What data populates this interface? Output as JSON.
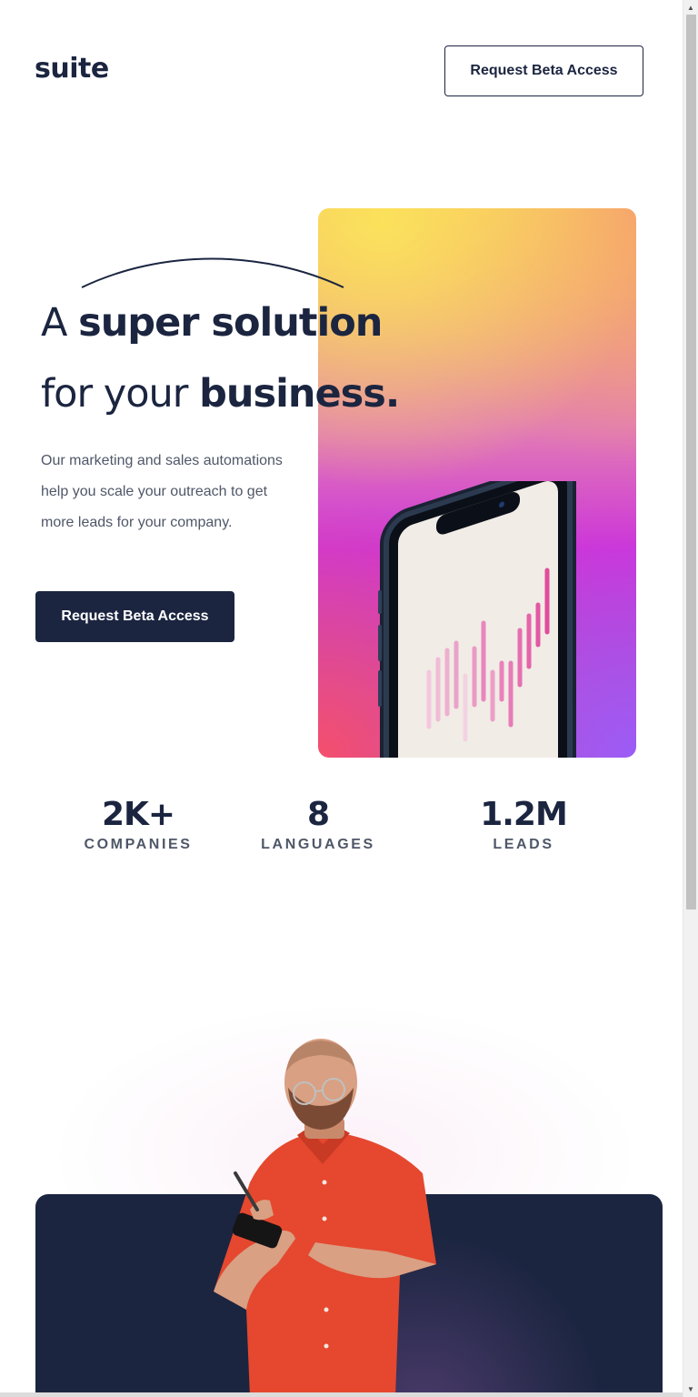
{
  "header": {
    "logo": "suite",
    "cta_label": "Request Beta Access"
  },
  "hero": {
    "headline_line1_light": "A ",
    "headline_line1_bold": "super solution",
    "headline_line2_light": "for your ",
    "headline_line2_bold": "business.",
    "description_line1": "Our marketing and sales automations",
    "description_line2": "help you scale your outreach to get",
    "description_line3": "more leads for your company.",
    "cta_label": "Request Beta Access"
  },
  "stats": [
    {
      "value": "2K+",
      "label": "COMPANIES"
    },
    {
      "value": "8",
      "label": "LANGUAGES"
    },
    {
      "value": "1.2M",
      "label": "LEADS"
    }
  ],
  "colors": {
    "navy": "#1b2540",
    "text_gray": "#4f5768",
    "gradient_yellow": "#fbe15c",
    "gradient_magenta": "#cc36d9",
    "gradient_red": "#f44f6c",
    "gradient_purple": "#9b5cf7",
    "shirt_red": "#e5482f"
  },
  "icons": {
    "scroll_up": "triangle-up-icon",
    "scroll_down": "triangle-down-icon"
  }
}
